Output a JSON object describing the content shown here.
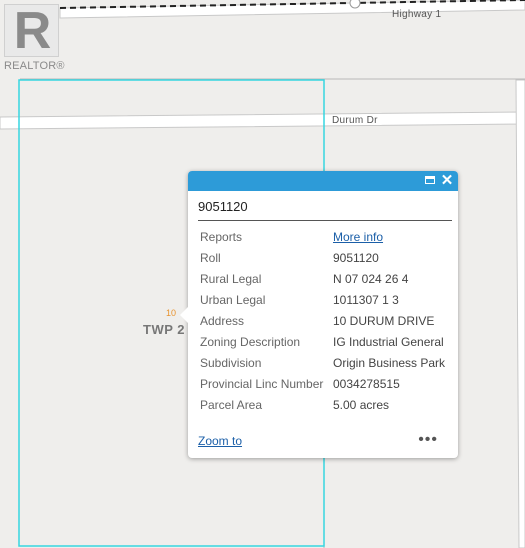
{
  "branding": {
    "logo_letter": "R",
    "logo_text": "REALTOR®"
  },
  "map": {
    "roads": [
      {
        "name": "Highway 1"
      },
      {
        "name": "Durum Dr"
      }
    ],
    "parcel": {
      "label": "TWP 2",
      "number": "10"
    },
    "colors": {
      "background": "#efeeec",
      "parcel_outline": "#37d6e0",
      "road": "#ffffff",
      "road_edge": "#c9c9c9"
    }
  },
  "popup": {
    "title": "9051120",
    "fields": [
      {
        "key": "Reports",
        "value": "More info",
        "link": true
      },
      {
        "key": "Roll",
        "value": "9051120"
      },
      {
        "key": "Rural Legal",
        "value": "N 07 024 26 4"
      },
      {
        "key": "Urban Legal",
        "value": "1011307 1 3"
      },
      {
        "key": "Address",
        "value": "10 DURUM DRIVE"
      },
      {
        "key": "Zoning Description",
        "value": "IG Industrial General"
      },
      {
        "key": "Subdivision",
        "value": "Origin Business Park"
      },
      {
        "key": "Provincial Linc Number",
        "value": "0034278515"
      },
      {
        "key": "Parcel Area",
        "value": "5.00 acres"
      }
    ],
    "zoom_label": "Zoom to",
    "more_label": "•••",
    "header_color": "#2d9bd8",
    "icons": {
      "maximize": "maximize-icon",
      "close": "close-icon",
      "more": "more-icon"
    }
  }
}
